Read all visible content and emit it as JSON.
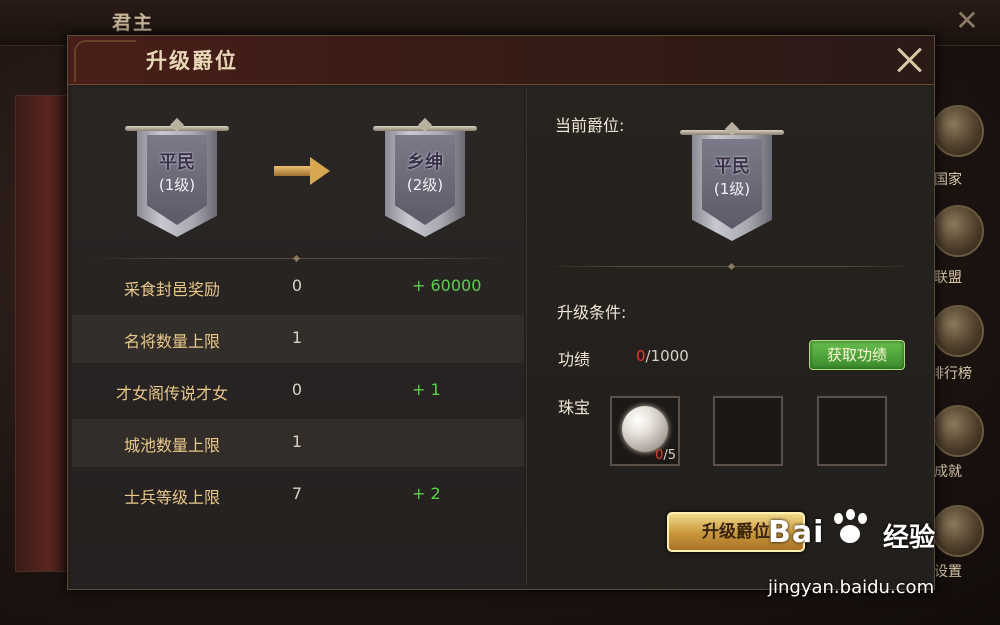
{
  "background": {
    "title": "君主",
    "side_menu": [
      {
        "label": "国家",
        "icon": "castle-icon"
      },
      {
        "label": "联盟",
        "icon": "alliance-helmet-icon"
      },
      {
        "label": "排行榜",
        "icon": "ranking-icon"
      },
      {
        "label": "成就",
        "icon": "achievement-icon"
      },
      {
        "label": "设置",
        "icon": "gear-icon"
      }
    ]
  },
  "dialog": {
    "title": "升级爵位",
    "from_rank": {
      "name": "平民",
      "level": "(1级)"
    },
    "to_rank": {
      "name": "乡绅",
      "level": "(2级)"
    },
    "rewards": [
      {
        "name": "采食封邑奖励",
        "current": "0",
        "add": "+ 60000"
      },
      {
        "name": "名将数量上限",
        "current": "1",
        "add": ""
      },
      {
        "name": "才女阁传说才女",
        "current": "0",
        "add": "+ 1"
      },
      {
        "name": "城池数量上限",
        "current": "1",
        "add": ""
      },
      {
        "name": "士兵等级上限",
        "current": "7",
        "add": "+ 2"
      }
    ],
    "current_title_label": "当前爵位:",
    "current_rank": {
      "name": "平民",
      "level": "(1级)"
    },
    "conditions_label": "升级条件:",
    "merit_label": "功绩",
    "merit_have": "0",
    "merit_need": "/1000",
    "get_merit_button": "获取功绩",
    "jewel_label": "珠宝",
    "jewel_slots": [
      {
        "item": "pearl-icon",
        "have": "0",
        "need": "/5"
      },
      {
        "item": "",
        "have": "",
        "need": ""
      },
      {
        "item": "",
        "have": "",
        "need": ""
      }
    ],
    "upgrade_button": "升级爵位"
  },
  "watermark": {
    "logo": "Bai",
    "logo2": "经验",
    "url": "jingyan.baidu.com"
  },
  "colors": {
    "gold_text": "#e8c88a",
    "green_bonus": "#5ad04a",
    "red_value": "#e03c30"
  }
}
